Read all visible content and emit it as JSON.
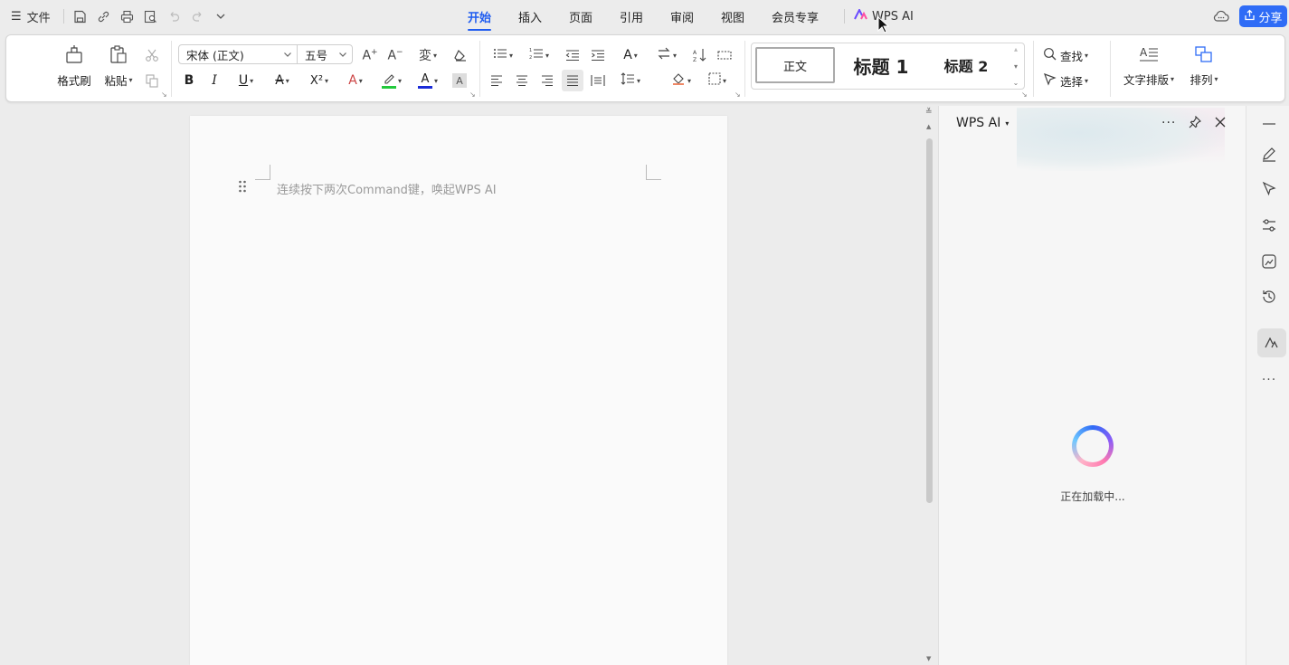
{
  "topbar": {
    "file_label": "文件",
    "tabs": [
      "开始",
      "插入",
      "页面",
      "引用",
      "审阅",
      "视图",
      "会员专享"
    ],
    "wps_ai_label": "WPS AI",
    "share_label": "分享"
  },
  "ribbon": {
    "format_painter": "格式刷",
    "paste": "粘贴",
    "font_name": "宋体 (正文)",
    "font_size": "五号",
    "styles": {
      "normal": "正文",
      "heading1": "标题 1",
      "heading2": "标题 2"
    },
    "find": "查找",
    "select": "选择",
    "text_layout": "文字排版",
    "arrange": "排列"
  },
  "document": {
    "placeholder": "连续按下两次Command键，唤起WPS AI"
  },
  "ai_panel": {
    "title": "WPS AI",
    "loading_text": "正在加载中..."
  },
  "colors": {
    "accent": "#1f5cf0",
    "share_button": "#2f6cf6",
    "highlight_green": "#23c93c",
    "font_color_blue": "#1a2bd8"
  }
}
